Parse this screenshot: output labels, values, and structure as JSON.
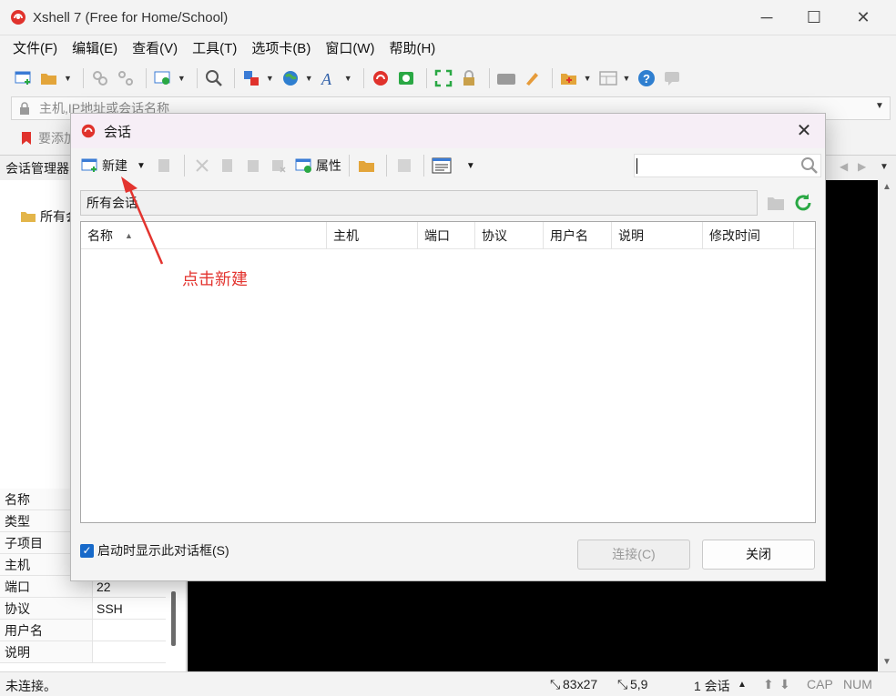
{
  "app": {
    "title": "Xshell 7 (Free for Home/School)",
    "controls": {
      "minimize": "─",
      "maximize": "☐",
      "close": "✕"
    }
  },
  "menu": {
    "items": [
      {
        "label": "文件(F)"
      },
      {
        "label": "编辑(E)"
      },
      {
        "label": "查看(V)"
      },
      {
        "label": "工具(T)"
      },
      {
        "label": "选项卡(B)"
      },
      {
        "label": "窗口(W)"
      },
      {
        "label": "帮助(H)"
      }
    ]
  },
  "addressbar": {
    "placeholder": "主机,IP地址或会话名称"
  },
  "quickbar": {
    "text": "要添加"
  },
  "sidebar": {
    "title": "会话管理器",
    "tree_root": "所有会",
    "props": [
      {
        "key": "名称",
        "value": ""
      },
      {
        "key": "类型",
        "value": ""
      },
      {
        "key": "子项目",
        "value": ""
      },
      {
        "key": "主机",
        "value": ""
      },
      {
        "key": "端口",
        "value": "22"
      },
      {
        "key": "协议",
        "value": "SSH"
      },
      {
        "key": "用户名",
        "value": ""
      },
      {
        "key": "说明",
        "value": ""
      }
    ]
  },
  "status": {
    "left": "未连接。",
    "size": "83x27",
    "pos": "5,9",
    "sessions": "1 会话",
    "cap": "CAP",
    "num": "NUM"
  },
  "dialog": {
    "title": "会话",
    "toolbar": {
      "new_label": "新建",
      "props_label": "属性"
    },
    "path": "所有会话",
    "columns": [
      {
        "label": "名称",
        "width": 270
      },
      {
        "label": "主机",
        "width": 100
      },
      {
        "label": "端口",
        "width": 63
      },
      {
        "label": "协议",
        "width": 75
      },
      {
        "label": "用户名",
        "width": 75
      },
      {
        "label": "说明",
        "width": 100
      },
      {
        "label": "修改时间",
        "width": 100
      }
    ],
    "startup_checkbox": "启动时显示此对话框(S)",
    "connect_button": "连接(C)",
    "close_button": "关闭"
  },
  "annotation": {
    "text": "点击新建",
    "color": "#e3342f"
  },
  "colors": {
    "accent": "#1769c9",
    "terminal_bg": "#000000",
    "annotation": "#e3342f"
  }
}
